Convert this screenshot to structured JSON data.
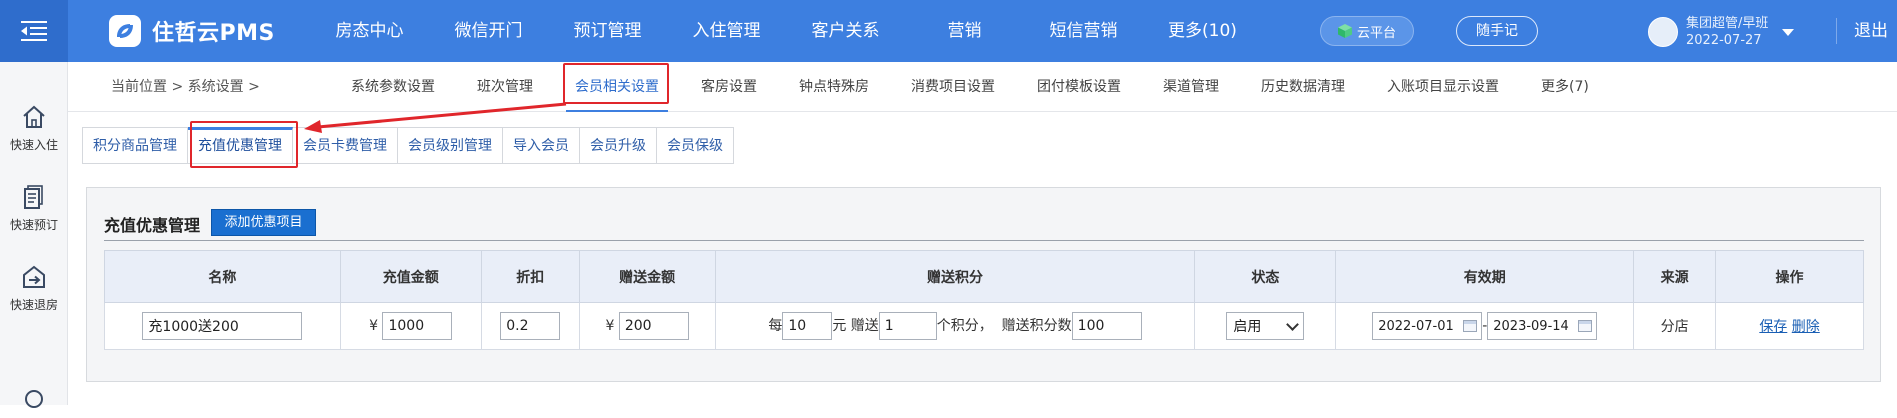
{
  "app": {
    "name": "住哲云PMS"
  },
  "nav": [
    "房态中心",
    "微信开门",
    "预订管理",
    "入住管理",
    "客户关系",
    "营销",
    "短信营销",
    "更多(10)"
  ],
  "header": {
    "cloud_label": "云平台",
    "memo_label": "随手记",
    "user_name": "集团超管/早班",
    "user_date": "2022-07-27",
    "logout_label": "退出"
  },
  "sidebar": {
    "items": [
      {
        "label": "快速入住",
        "icon": "home-icon"
      },
      {
        "label": "快速预订",
        "icon": "booking-icon"
      },
      {
        "label": "快速退房",
        "icon": "checkout-icon"
      }
    ]
  },
  "breadcrumb": {
    "text": "当前位置 > 系统设置 >"
  },
  "subnav": [
    "系统参数设置",
    "班次管理",
    "会员相关设置",
    "客房设置",
    "钟点特殊房",
    "消费项目设置",
    "团付模板设置",
    "渠道管理",
    "历史数据清理",
    "入账项目显示设置",
    "更多(7)"
  ],
  "tabs": [
    "积分商品管理",
    "充值优惠管理",
    "会员卡费管理",
    "会员级别管理",
    "导入会员",
    "会员升级",
    "会员保级"
  ],
  "panel": {
    "title": "充值优惠管理",
    "add_button": "添加优惠项目"
  },
  "table": {
    "headers": [
      "名称",
      "充值金额",
      "折扣",
      "赠送金额",
      "赠送积分",
      "状态",
      "有效期",
      "来源",
      "操作"
    ],
    "row": {
      "name": "充1000送200",
      "currency": "¥",
      "amount": "1000",
      "discount": "0.2",
      "gift_amount": "200",
      "points_per": "每",
      "points_unit": "10",
      "points_yuan": "元 赠送",
      "points_give": "1",
      "points_suffix": "个积分，",
      "points_total_label": "赠送积分数",
      "points_total": "100",
      "status": "启用",
      "date_from": "2022-07-01",
      "date_sep": "-",
      "date_to": "2023-09-14",
      "source": "分店",
      "save": "保存",
      "delete": "删除"
    }
  },
  "colors": {
    "primary": "#3d7fe0",
    "annotation": "#e0262b",
    "button": "#1a6fd0"
  }
}
